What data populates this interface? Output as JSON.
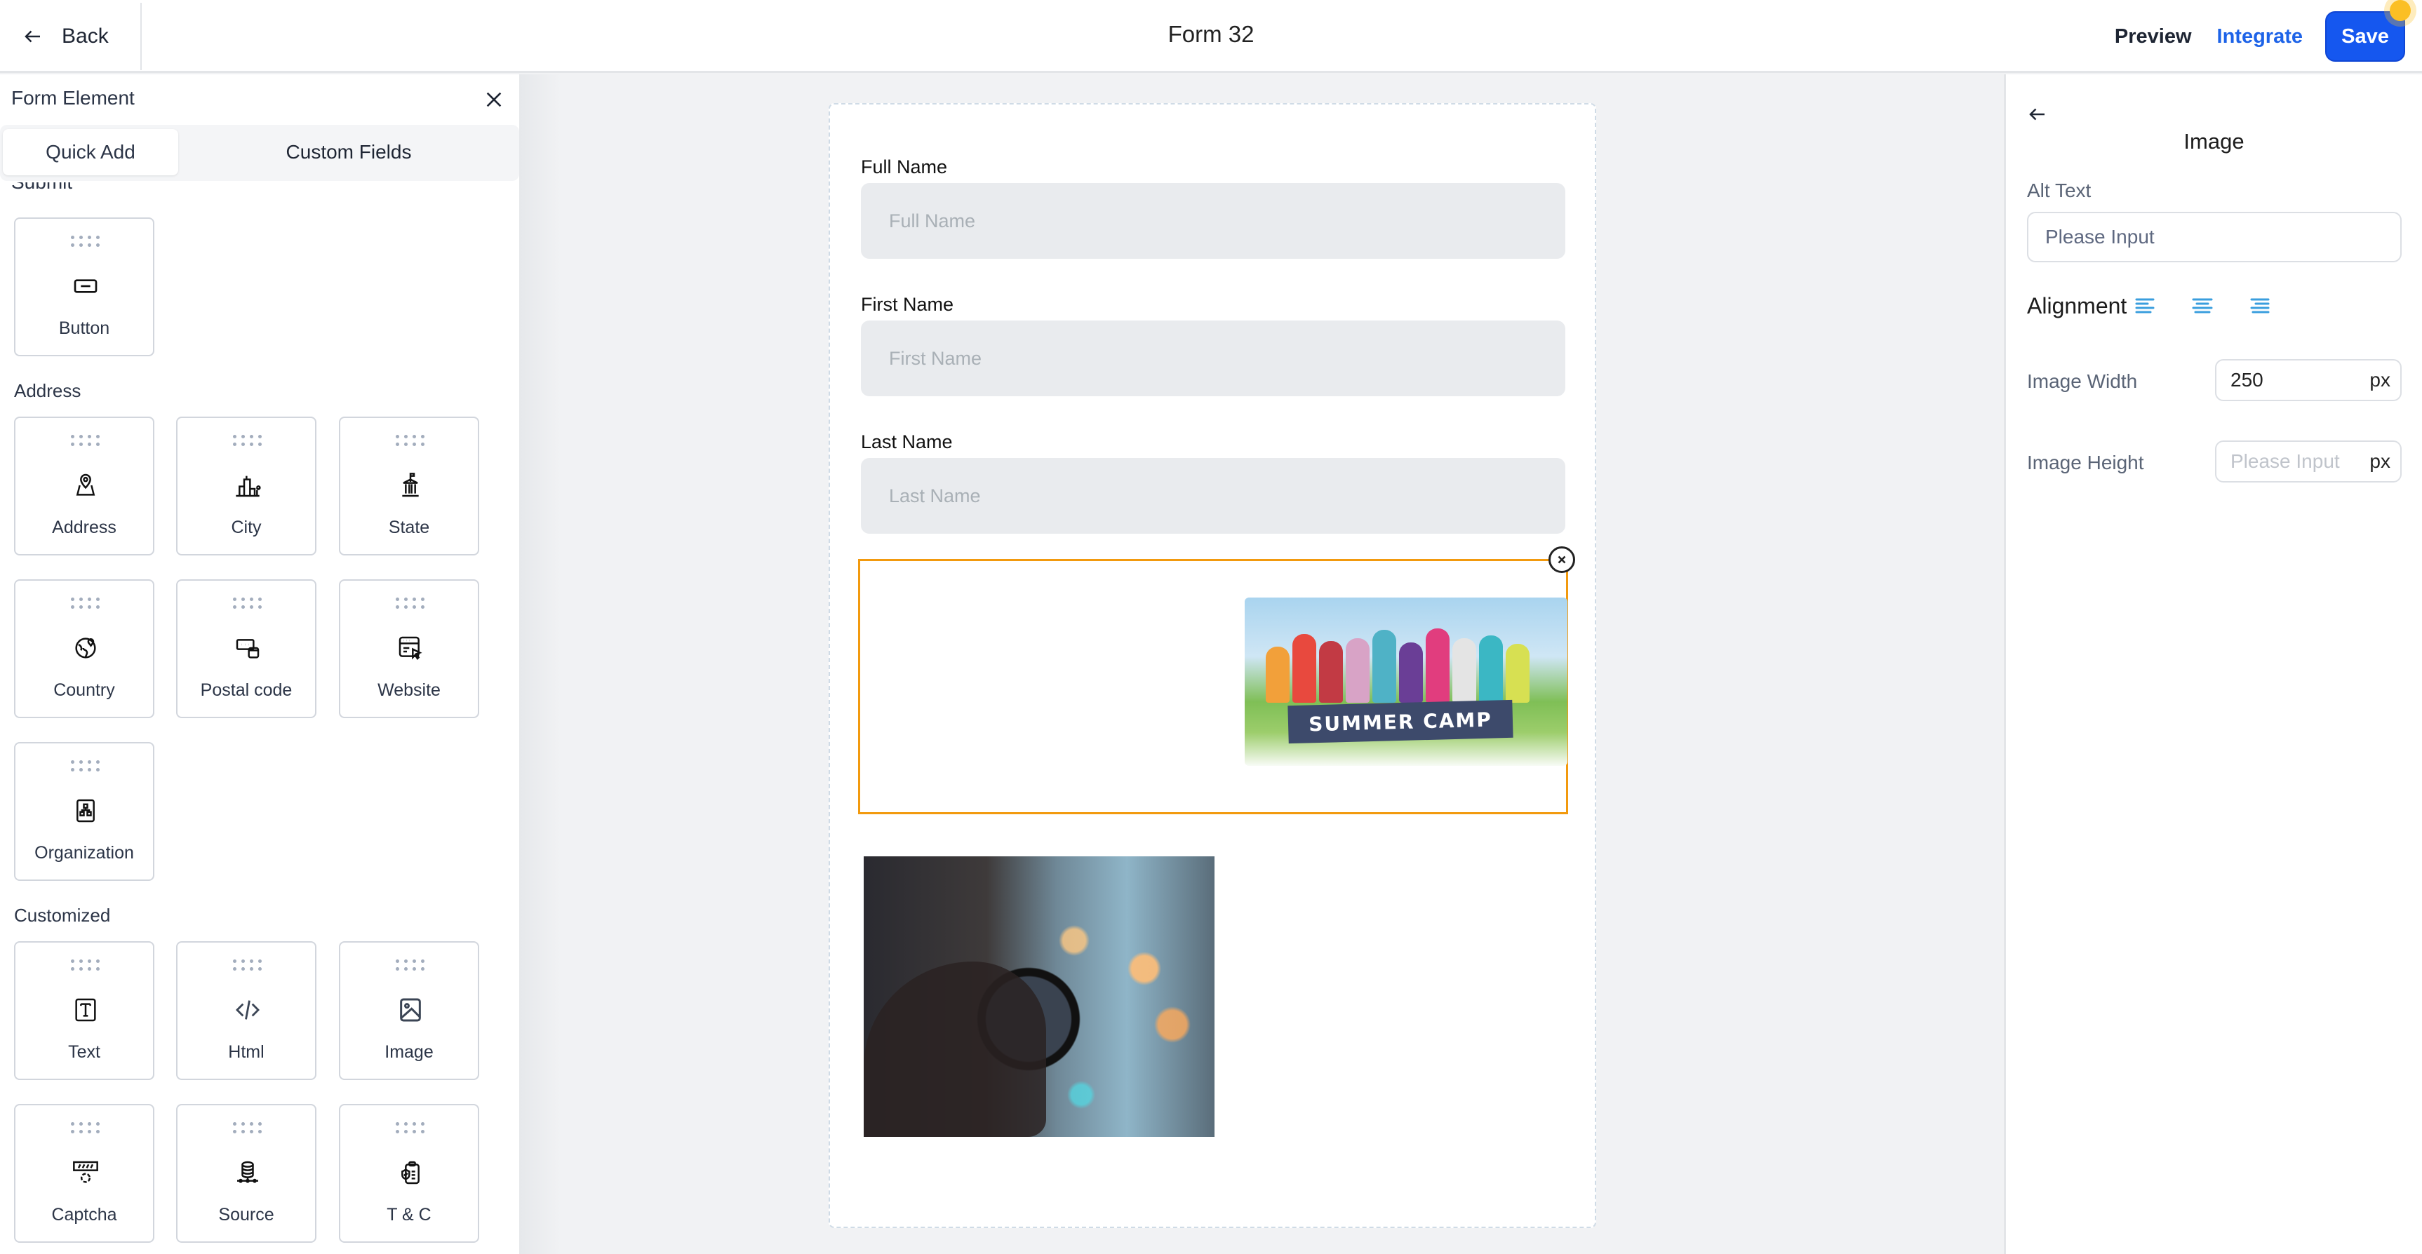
{
  "header": {
    "back_label": "Back",
    "form_title": "Form 32",
    "preview_label": "Preview",
    "integrate_label": "Integrate",
    "save_label": "Save",
    "accent_color": "#1557ef"
  },
  "sidebar": {
    "title": "Form Element",
    "tabs": [
      {
        "label": "Quick Add",
        "active": true
      },
      {
        "label": "Custom Fields",
        "active": false
      }
    ],
    "cutoff_section": "Submit",
    "sections": [
      {
        "label": "Address"
      },
      {
        "label": "Customized"
      }
    ],
    "elements": {
      "button": {
        "label": "Button",
        "icon": "button-icon"
      },
      "address": {
        "label": "Address",
        "icon": "map-pin-icon"
      },
      "city": {
        "label": "City",
        "icon": "city-icon"
      },
      "state": {
        "label": "State",
        "icon": "state-building-icon"
      },
      "country": {
        "label": "Country",
        "icon": "globe-icon"
      },
      "postal_code": {
        "label": "Postal code",
        "icon": "postal-code-icon"
      },
      "website": {
        "label": "Website",
        "icon": "website-icon"
      },
      "organization": {
        "label": "Organization",
        "icon": "organization-icon"
      },
      "text": {
        "label": "Text",
        "icon": "text-icon"
      },
      "html": {
        "label": "Html",
        "icon": "code-icon"
      },
      "image": {
        "label": "Image",
        "icon": "image-icon"
      },
      "captcha": {
        "label": "Captcha",
        "icon": "captcha-icon"
      },
      "source": {
        "label": "Source",
        "icon": "database-icon"
      },
      "tc": {
        "label": "T & C",
        "icon": "terms-shield-icon"
      }
    }
  },
  "form": {
    "fields": [
      {
        "label": "Full Name",
        "placeholder": "Full Name"
      },
      {
        "label": "First Name",
        "placeholder": "First Name"
      },
      {
        "label": "Last Name",
        "placeholder": "Last Name"
      }
    ],
    "selected_image_text": "SUMMER CAMP",
    "selected_border_color": "#f29a0e"
  },
  "properties": {
    "title": "Image",
    "alt_text_label": "Alt Text",
    "alt_text_placeholder": "Please Input",
    "alignment_label": "Alignment",
    "alignment_options": [
      "left",
      "center",
      "right"
    ],
    "image_width_label": "Image Width",
    "image_width_value": "250",
    "image_height_label": "Image Height",
    "image_height_placeholder": "Please Input",
    "unit": "px"
  }
}
